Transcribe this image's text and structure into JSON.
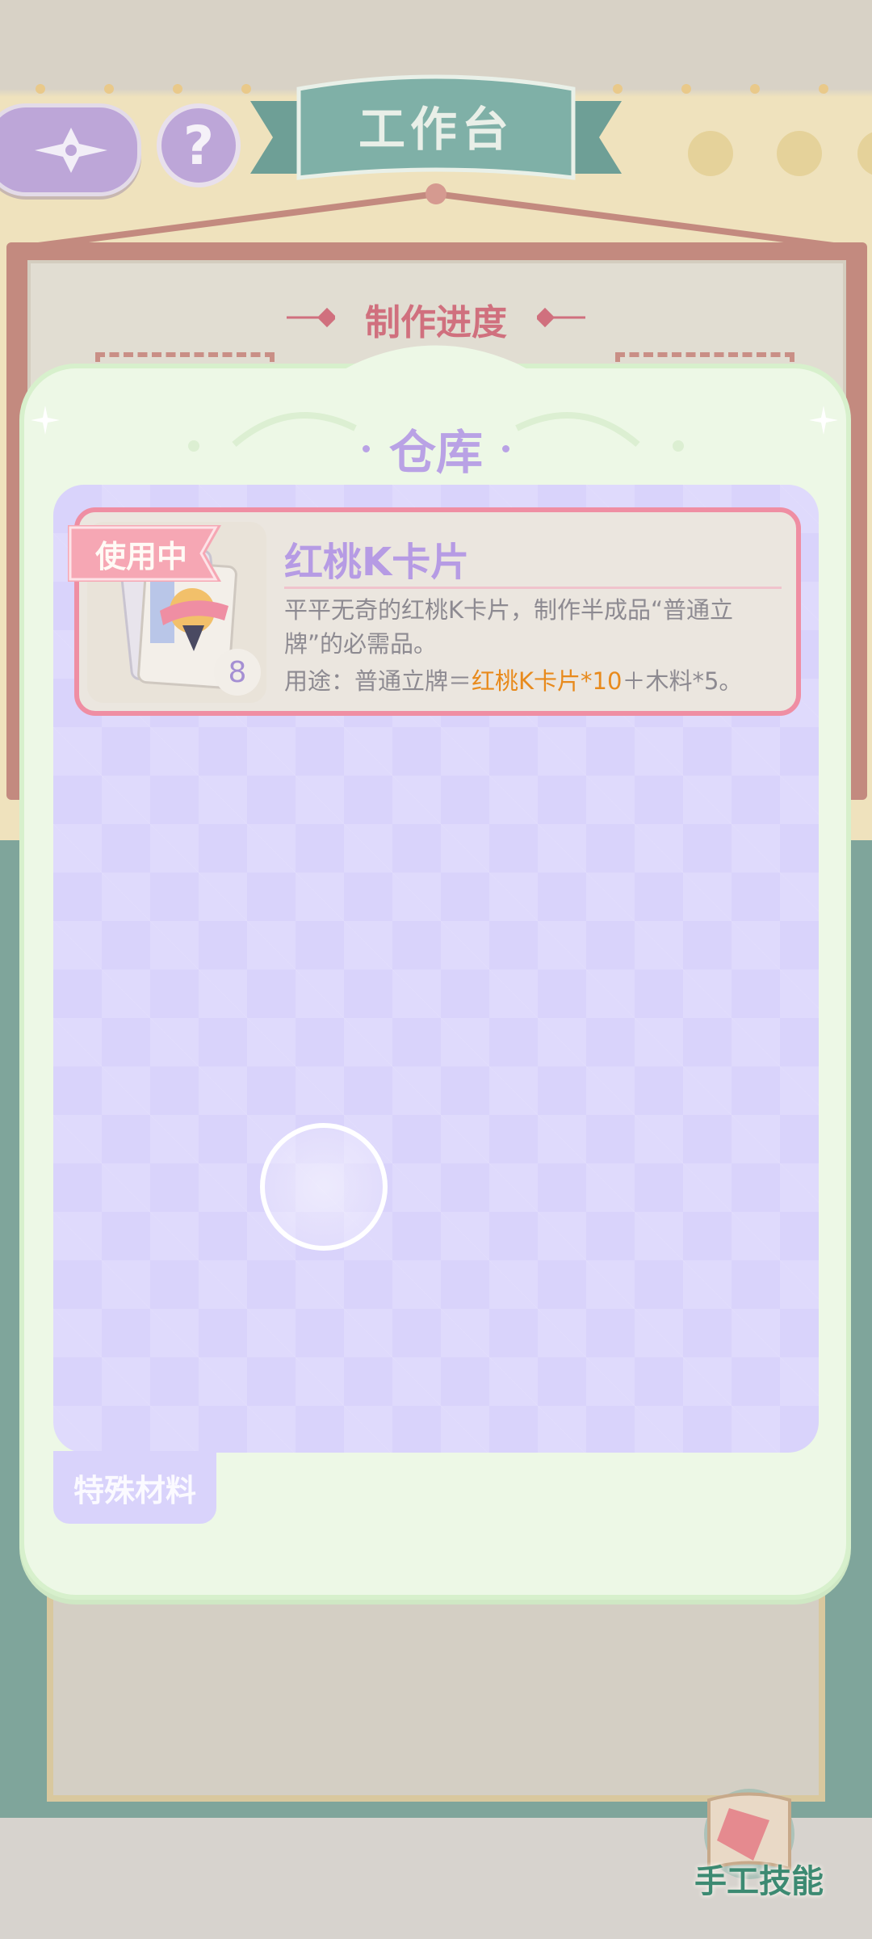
{
  "header": {
    "title": "工作台",
    "help_label": "?",
    "back_icon": "sparkle-back-icon"
  },
  "workbench": {
    "progress_title": "制作进度"
  },
  "warehouse": {
    "title": "仓库",
    "items": [
      {
        "tag": "使用中",
        "name": "红桃K卡片",
        "count": "8",
        "description": "平平无奇的红桃K卡片，制作半成品“普通立牌”的必需品。",
        "usage_prefix": "用途：普通立牌＝",
        "usage_highlight": "红桃K卡片*10",
        "usage_suffix": "＋木料*5。",
        "icon": "playing-card-icon"
      }
    ],
    "tab_label": "特殊材料"
  },
  "footer": {
    "craft_skill_label": "手工技能",
    "craft_skill_icon": "scroll-card-icon"
  },
  "colors": {
    "accent_purple": "#b9a2e5",
    "tag_pink": "#ef8ea3",
    "highlight_orange": "#e88a1c",
    "ribbon_teal": "#7fb0a7"
  }
}
